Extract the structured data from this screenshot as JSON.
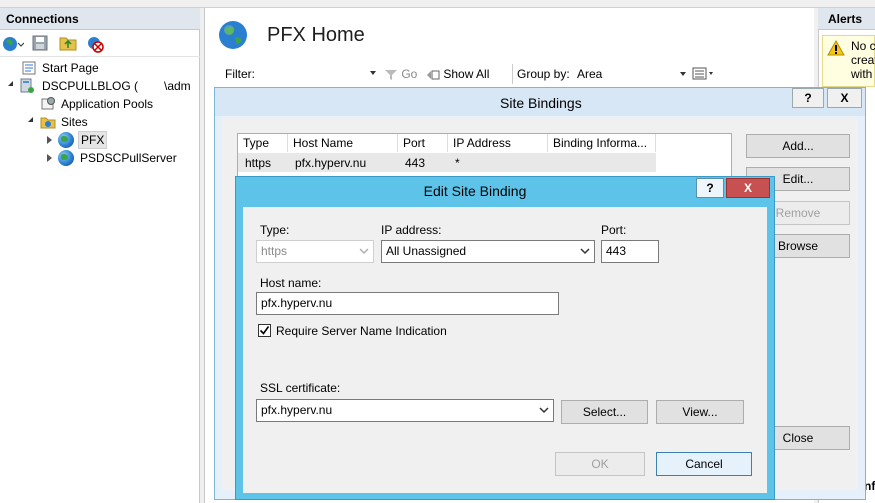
{
  "connections": {
    "title": "Connections",
    "toolbar": [
      "connect-icon",
      "save-icon",
      "folder-up-icon",
      "disconnect-icon"
    ],
    "tree": {
      "start_page": "Start Page",
      "server": "DSCPULLBLOG (",
      "server_user": "\\adm",
      "app_pools": "Application Pools",
      "sites": "Sites",
      "site_pfx": "PFX",
      "site_pull": "PSDSCPullServer"
    }
  },
  "main": {
    "title": "PFX Home",
    "filter_label": "Filter:",
    "go_label": "Go",
    "show_all_label": "Show All",
    "group_by_label": "Group by:",
    "group_by_value": "Area"
  },
  "alerts": {
    "title": "Alerts",
    "message": "No c creat with",
    "config_label": "Conf"
  },
  "site_bindings": {
    "title": "Site Bindings",
    "help": "?",
    "close": "X",
    "columns": [
      "Type",
      "Host Name",
      "Port",
      "IP Address",
      "Binding Informa..."
    ],
    "rows": [
      {
        "type": "https",
        "host": "pfx.hyperv.nu",
        "port": "443",
        "ip": "*",
        "info": ""
      }
    ],
    "buttons": {
      "add": "Add...",
      "edit": "Edit...",
      "remove": "Remove",
      "browse": "Browse",
      "close": "Close"
    }
  },
  "edit_binding": {
    "title": "Edit Site Binding",
    "help": "?",
    "close": "X",
    "type_label": "Type:",
    "type_value": "https",
    "ip_label": "IP address:",
    "ip_value": "All Unassigned",
    "port_label": "Port:",
    "port_value": "443",
    "host_label": "Host name:",
    "host_value": "pfx.hyperv.nu",
    "sni_label": "Require Server Name Indication",
    "sni_checked": true,
    "ssl_label": "SSL certificate:",
    "ssl_value": "pfx.hyperv.nu",
    "select_button": "Select...",
    "view_button": "View...",
    "ok_button": "OK",
    "cancel_button": "Cancel"
  }
}
